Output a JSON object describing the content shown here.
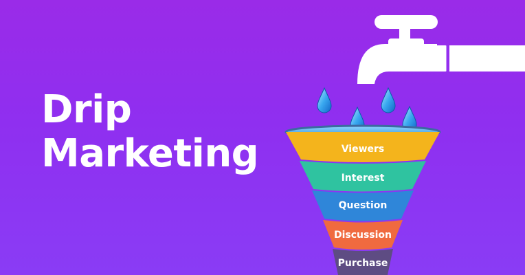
{
  "headline": {
    "line1": "Drip",
    "line2": "Marketing"
  },
  "icons": [
    "faucet-icon",
    "water-drop-icon",
    "funnel-icon"
  ],
  "funnel": {
    "stages": [
      {
        "label": "Viewers",
        "color": "#f4b41c"
      },
      {
        "label": "Interest",
        "color": "#2fc3a0"
      },
      {
        "label": "Question",
        "color": "#2f86d9"
      },
      {
        "label": "Discussion",
        "color": "#f06a3f"
      },
      {
        "label": "Purchase",
        "color": "#5e4c83"
      }
    ]
  },
  "colors": {
    "background": "#9430ef",
    "text": "#ffffff",
    "water": "#3aa9f0"
  }
}
